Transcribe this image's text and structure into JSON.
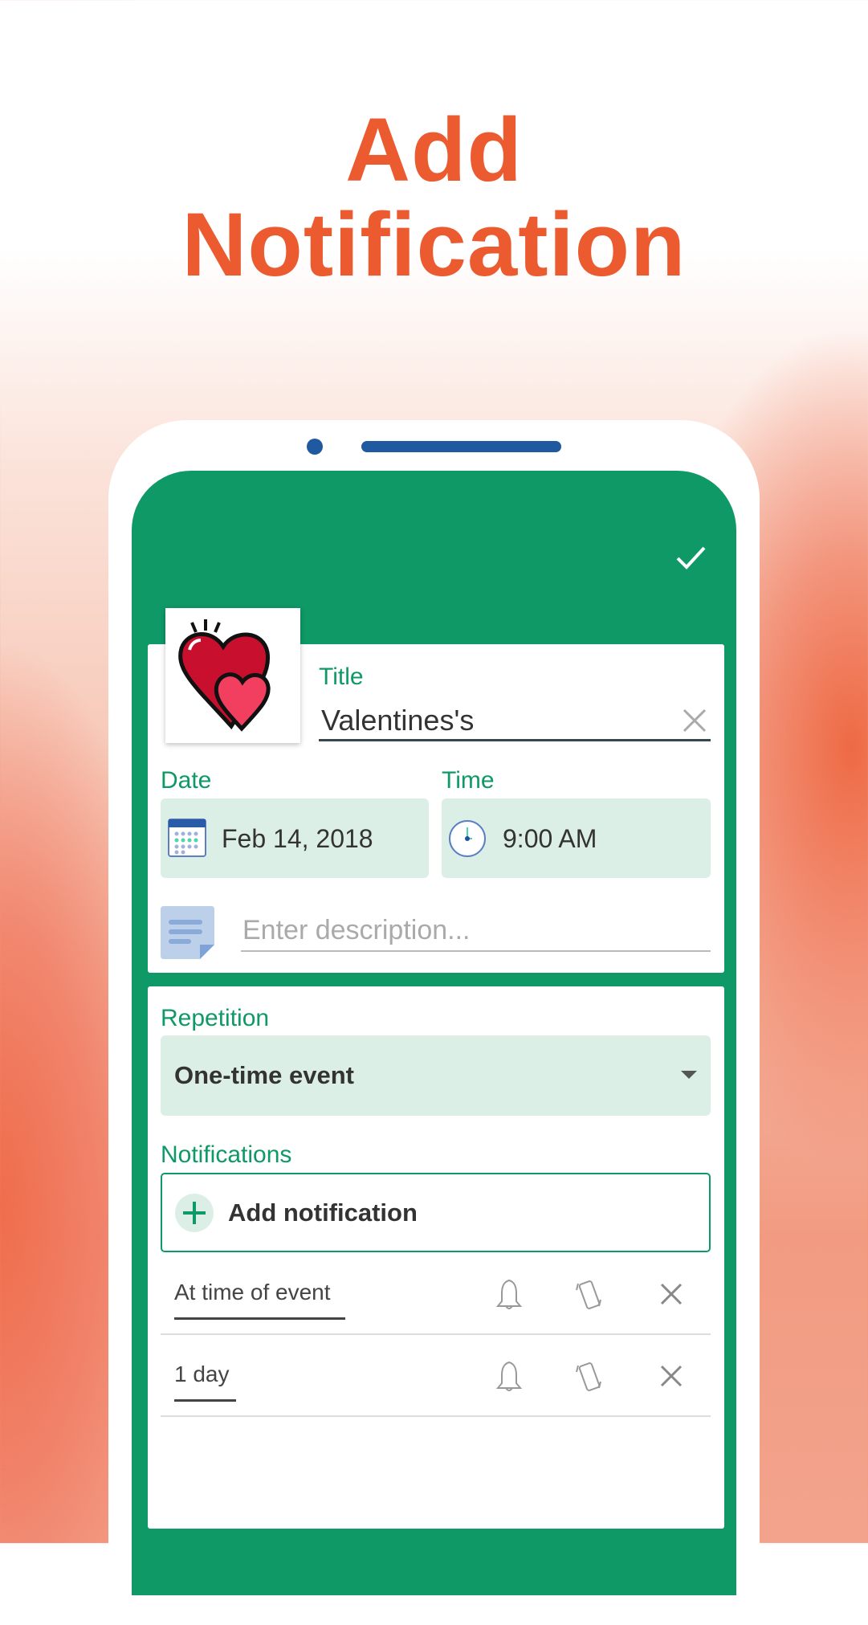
{
  "headline": {
    "line1": "Add",
    "line2": "Notification"
  },
  "toolbar": {
    "confirm_icon": "checkmark-icon"
  },
  "event": {
    "icon": "hearts-icon",
    "title_label": "Title",
    "title_value": "Valentines's",
    "date_label": "Date",
    "date_value": "Feb 14, 2018",
    "time_label": "Time",
    "time_value": "9:00 AM",
    "description_placeholder": "Enter description..."
  },
  "repetition": {
    "label": "Repetition",
    "value": "One-time event"
  },
  "notifications": {
    "label": "Notifications",
    "add_label": "Add notification",
    "items": [
      {
        "value": "At time of event"
      },
      {
        "value": "1 day"
      }
    ]
  },
  "colors": {
    "accent": "#0e9966",
    "headline": "#ec5a30",
    "field_bg": "#dcefe6"
  }
}
